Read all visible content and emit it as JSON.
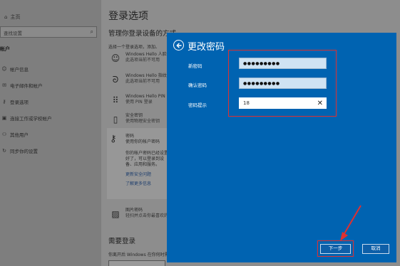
{
  "sidebar": {
    "home": "主页",
    "search_placeholder": "查找设置",
    "section": "帐户",
    "items": [
      {
        "label": "帐户信息",
        "icon": "person-icon"
      },
      {
        "label": "电子邮件和帐户",
        "icon": "mail-icon"
      },
      {
        "label": "登录选项",
        "icon": "key-icon"
      },
      {
        "label": "连接工作或学校帐户",
        "icon": "briefcase-icon"
      },
      {
        "label": "其他用户",
        "icon": "people-icon"
      },
      {
        "label": "同步你的设置",
        "icon": "sync-icon"
      }
    ]
  },
  "main": {
    "title": "登录选项",
    "subtitle": "管理你登录设备的方式",
    "choose": "选择一个登录选项，添加、",
    "options": [
      {
        "title": "Windows Hello 人脸",
        "sub": "此选项当前不可用",
        "icon": "face-icon"
      },
      {
        "title": "Windows Hello 指纹",
        "sub": "此选项当前不可用",
        "icon": "fingerprint-icon"
      },
      {
        "title": "Windows Hello PIN",
        "sub": "使用 PIN 登录",
        "icon": "keypad-icon"
      },
      {
        "title": "安全密钥",
        "sub": "使用物理安全密钥",
        "icon": "usb-key-icon"
      }
    ],
    "password": {
      "title": "密码",
      "sub": "使用你的帐户密码",
      "desc": "你的帐户密码已经设置好了，可以登录到设备、应用和服务。",
      "link1": "更新安全问题",
      "link2": "了解更多信息"
    },
    "picture_password": {
      "title": "图片密码",
      "sub": "轻扫并点击你最喜欢的"
    },
    "require_title": "需要登录",
    "require_sub": "你离开后 Windows 在你何时需要重"
  },
  "dialog": {
    "title": "更改密码",
    "fields": {
      "new_label": "新密码",
      "new_value": "●●●●●●●●●",
      "confirm_label": "确认密码",
      "confirm_value": "●●●●●●●●●",
      "hint_label": "密码提示",
      "hint_value": "18"
    },
    "next_label": "下一步",
    "cancel_label": "取消"
  },
  "colors": {
    "dialog_bg": "#0063b1",
    "highlight": "#e03030"
  }
}
